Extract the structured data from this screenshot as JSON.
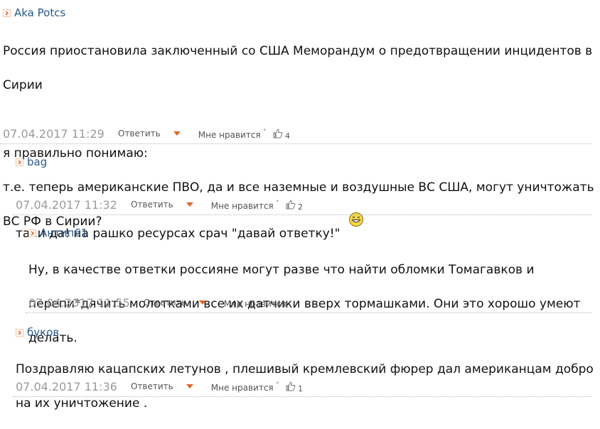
{
  "comments": [
    {
      "author": "Aka Potcs",
      "text_line1": "Россия приостановила заключенный со США Меморандум о предотвращении инцидентов в",
      "text_line2": "Сирии",
      "text_line3": "я правильно понимаю:",
      "text_line4": "т.е. теперь американские ПВО, да и все наземные и воздушные ВС США, могут уничтожать",
      "text_line5": "ВС РФ в Сирии?",
      "date": "07.04.2017 11:29",
      "reply_label": "Ответить",
      "like_label": "Мне нравится",
      "likes": "4"
    },
    {
      "author": "bag",
      "text": "таки да! на рашко ресурсах срач \"давай ответку!\"",
      "date": "07.04.2017 11:32",
      "reply_label": "Ответить",
      "like_label": "Мне нравится",
      "likes": "2"
    },
    {
      "author": "Антип61",
      "text_line1": "Ну, в качестве ответки россияне могут разве что найти обломки Томагавков и",
      "text_line2": "перепи*дячить молотками все их датчики вверх тормашками. Они это хорошо умеют",
      "text_line3": "делать.",
      "date": "07.04.2017 11:55",
      "reply_label": "Ответить",
      "like_label": "Мне нравится"
    },
    {
      "author": "буков",
      "text_line1": "Поздравляю кацапских летунов , плешивый кремлевский фюрер дал американцам добро",
      "text_line2": "на их уничтожение .",
      "date": "07.04.2017 11:36",
      "reply_label": "Ответить",
      "like_label": "Мне нравится",
      "likes": "1"
    }
  ],
  "colors": {
    "author": "#2a5a8a",
    "accent": "#e0662a",
    "date": "#9a9a9a"
  },
  "icons": {
    "author_marker": "chevron-right-icon",
    "like": "thumbs-up-icon",
    "reply_menu": "caret-down-icon",
    "emoticon": "smiley-icon"
  }
}
